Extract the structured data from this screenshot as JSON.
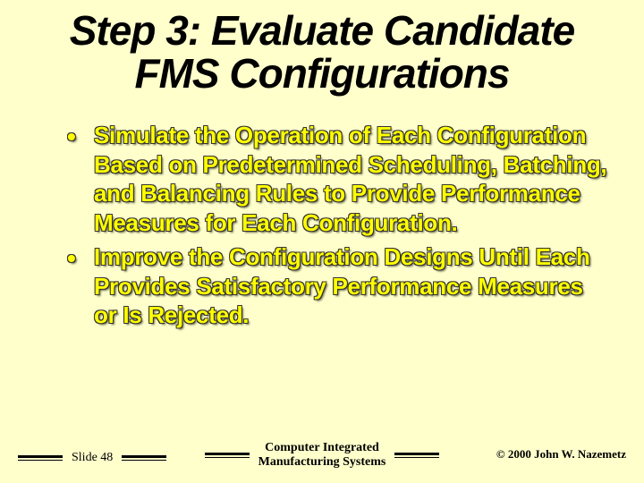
{
  "title": "Step 3: Evaluate Candidate FMS Configurations",
  "bullets": [
    "Simulate the Operation of Each Configuration Based on Predetermined Scheduling, Batching, and Balancing Rules to Provide Performance Measures for Each Configuration.",
    "Improve the Configuration Designs Until Each Provides Satisfactory Performance Measures or Is Rejected."
  ],
  "footer": {
    "slide_label": "Slide 48",
    "center_line1": "Computer Integrated",
    "center_line2": "Manufacturing Systems",
    "copyright": "© 2000  John W. Nazemetz"
  }
}
